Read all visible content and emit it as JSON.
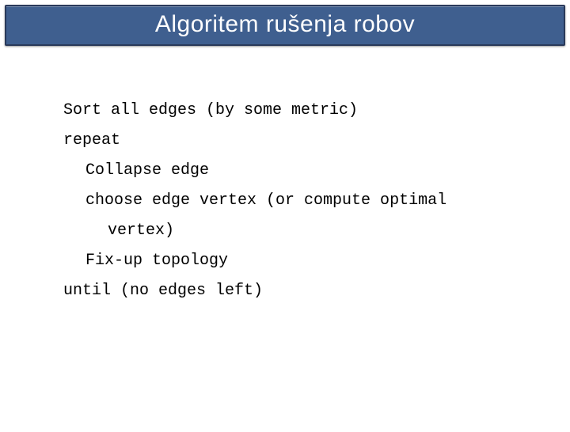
{
  "title": "Algoritem rušenja robov",
  "lines": {
    "l0": "Sort all edges (by some metric)",
    "l1": "repeat",
    "l2": "Collapse edge",
    "l3": "choose edge vertex (or compute optimal",
    "l3b": "vertex)",
    "l4": "Fix-up topology",
    "l5": "until (no edges left)"
  }
}
